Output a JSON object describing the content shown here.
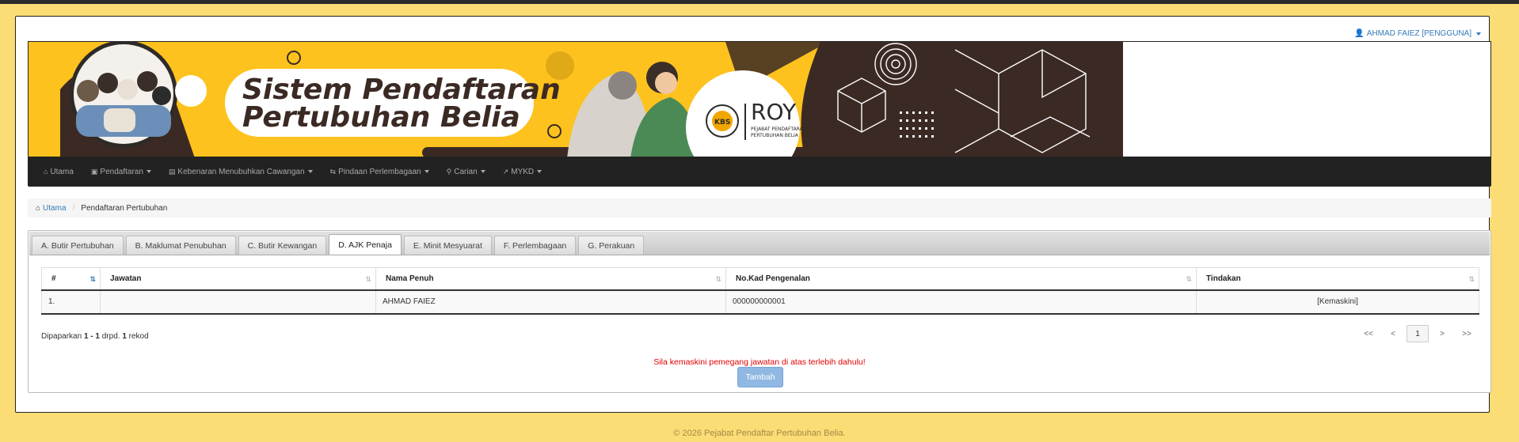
{
  "user": {
    "name": "AHMAD FAIEZ [PENGGUNA]"
  },
  "banner": {
    "title_line1": "Sistem  Pendaftaran",
    "title_line2": "Pertubuhan Belia",
    "logo_text": "ROY",
    "logo_sub1": "PEJABAT PENDAFTARAN",
    "logo_sub2": "PERTUBUHAN BELIA",
    "seal_text": "KBS"
  },
  "nav": {
    "items": [
      {
        "label": "Utama",
        "icon": "home-icon"
      },
      {
        "label": "Pendaftaran",
        "icon": "file-icon"
      },
      {
        "label": "Kebenaran Menubuhkan Cawangan",
        "icon": "folder-icon"
      },
      {
        "label": "Pindaan Perlembagaan",
        "icon": "swap-icon"
      },
      {
        "label": "Carian",
        "icon": "search-icon"
      },
      {
        "label": "MYKD",
        "icon": "external-icon"
      }
    ]
  },
  "breadcrumb": {
    "home": "Utama",
    "current": "Pendaftaran Pertubuhan"
  },
  "tabs": [
    "A. Butir Pertubuhan",
    "B. Maklumat Penubuhan",
    "C. Butir Kewangan",
    "D. AJK Penaja",
    "E. Minit Mesyuarat",
    "F. Perlembagaan",
    "G. Perakuan"
  ],
  "table": {
    "headers": [
      "#",
      "Jawatan",
      "Nama Penuh",
      "No.Kad Pengenalan",
      "Tindakan"
    ],
    "rows": [
      {
        "no": "1.",
        "jawatan": "",
        "nama": "AHMAD FAIEZ",
        "ic": "000000000001",
        "action": "[Kemaskini]"
      }
    ]
  },
  "paging": {
    "prefix": "Dipaparkan",
    "range": "1 - 1",
    "mid": "drpd.",
    "total": "1",
    "suffix": "rekod",
    "first": "<<",
    "prev": "<",
    "page": "1",
    "next": ">",
    "last": ">>"
  },
  "warning": "Sila kemaskini pemegang jawatan di atas terlebih dahulu!",
  "add_button": "Tambah",
  "footer": "© 2026 Pejabat Pendaftar Pertubuhan Belia.",
  "colors": {
    "page_bg": "#fcdc74",
    "nav_bg": "#222222",
    "link": "#337ab7",
    "warning": "#e00000",
    "banner_yellow": "#fdc21d",
    "banner_dark": "#3b2a24"
  }
}
